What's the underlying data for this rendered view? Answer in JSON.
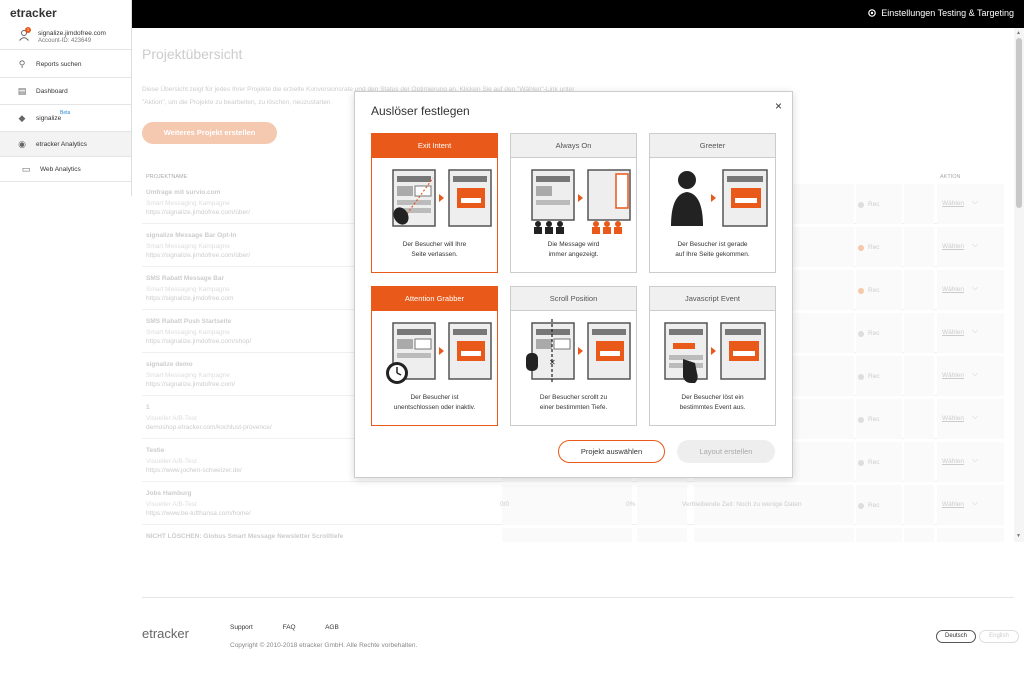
{
  "topbar": {
    "settings_label": "Einstellungen Testing & Targeting"
  },
  "sidebar": {
    "logo": "etracker",
    "account": {
      "name": "signalize.jimdofree.com",
      "id": "Account-ID: 423649"
    },
    "items": [
      {
        "label": "Reports suchen",
        "icon": "search-icon"
      },
      {
        "label": "Dashboard",
        "icon": "dashboard-icon"
      },
      {
        "label": "signalize",
        "icon": "signalize-icon",
        "badge": "Beta"
      },
      {
        "label": "etracker Analytics",
        "icon": "analytics-icon"
      },
      {
        "label": "Web Analytics",
        "icon": "web-analytics-icon"
      }
    ]
  },
  "main": {
    "title": "Projektübersicht",
    "description_1": "Diese Übersicht zeigt für jedes Ihrer Projekte die erzielte Konversionsrate und den Status der Optimierung an. Klicken Sie auf den \"Wählen\"-Link unter",
    "description_2": "\"Aktion\", um die Projekte zu bearbeiten, zu löschen, neuzustarten",
    "new_button": "Weiteres Projekt erstellen",
    "headers": {
      "name": "PROJEKTNAME",
      "action": "AKTION"
    },
    "rows": [
      {
        "title": "Umfrage mit survio.com",
        "sub": "Smart Messaging Kampagne",
        "url": "https://signalize.jimdofree.com/über/",
        "c1": "",
        "c2": "",
        "c3": "enige Daten",
        "rec": "Rec",
        "rec_on": false,
        "action": "Wählen"
      },
      {
        "title": "signalize Message Bar Opt-In",
        "sub": "Smart Messaging Kampagne",
        "url": "https://signalize.jimdofree.com/über/",
        "c1": "",
        "c2": "",
        "c3": "enige Daten",
        "rec": "Rec",
        "rec_on": true,
        "action": "Wählen"
      },
      {
        "title": "SMS Rabatt Message Bar",
        "sub": "Smart Messaging Kampagne",
        "url": "https://signalize.jimdofree.com",
        "c1": "",
        "c2": "",
        "c3": "enige Daten",
        "rec": "Rec",
        "rec_on": true,
        "action": "Wählen"
      },
      {
        "title": "SMS Rabatt Push Startseite",
        "sub": "Smart Messaging Kampagne",
        "url": "https://signalize.jimdofree.com/shop/",
        "c1": "",
        "c2": "",
        "c3": "enige Daten",
        "rec": "Rec",
        "rec_on": false,
        "action": "Wählen"
      },
      {
        "title": "signalize demo",
        "sub": "Smart Messaging Kampagne",
        "url": "https://signalize.jimdofree.com/",
        "c1": "",
        "c2": "",
        "c3": "enige Daten",
        "rec": "Rec",
        "rec_on": false,
        "action": "Wählen"
      },
      {
        "title": "1",
        "sub": "Visueller A/B-Test",
        "url": "demoshop.etracker.com/kochlust-provence/",
        "c1": "",
        "c2": "",
        "c3": "enige Daten",
        "rec": "Rec",
        "rec_on": false,
        "action": "Wählen"
      },
      {
        "title": "Testie",
        "sub": "Visueller A/B-Test",
        "url": "https://www.jochen-schweizer.de/",
        "c1": "",
        "c2": "",
        "c3": "enige Daten",
        "rec": "Rec",
        "rec_on": false,
        "action": "Wählen"
      },
      {
        "title": "Jobs Hamburg",
        "sub": "Visueller A/B-Test",
        "url": "https://www.be-lufthansa.com/home/",
        "c1": "0/0",
        "c2": "0%",
        "c3": "Verbleibende Zeit: Noch zu wenige Daten",
        "rec": "Rec",
        "rec_on": false,
        "action": "Wählen"
      },
      {
        "title": "NICHT LÖSCHEN: Globus Smart Message Newsletter Scrolltiefe",
        "sub": "",
        "url": "",
        "c1": "",
        "c2": "",
        "c3": "",
        "rec": "",
        "rec_on": false,
        "action": ""
      }
    ]
  },
  "modal": {
    "title": "Auslöser festlegen",
    "close": "×",
    "cards": [
      {
        "title": "Exit Intent",
        "desc_1": "Der Besucher will Ihre",
        "desc_2": "Seite verlassen.",
        "selected": true
      },
      {
        "title": "Always On",
        "desc_1": "Die Message wird",
        "desc_2": "immer angezeigt.",
        "selected": false
      },
      {
        "title": "Greeter",
        "desc_1": "Der Besucher ist gerade",
        "desc_2": "auf Ihre Seite gekommen.",
        "selected": false
      },
      {
        "title": "Attention Grabber",
        "desc_1": "Der Besucher ist",
        "desc_2": "unentschlossen oder inaktiv.",
        "selected": true
      },
      {
        "title": "Scroll Position",
        "desc_1": "Der Besucher scrollt zu",
        "desc_2": "einer bestimmten Tiefe.",
        "selected": false
      },
      {
        "title": "Javascript Event",
        "desc_1": "Der Besucher löst ein",
        "desc_2": "bestimmtes Event aus.",
        "selected": false
      }
    ],
    "select_button": "Projekt auswählen",
    "layout_button": "Layout erstellen"
  },
  "footer": {
    "logo": "etracker",
    "links": [
      "Support",
      "FAQ",
      "AGB"
    ],
    "copyright": "Copyright © 2010-2018 etracker GmbH. Alle Rechte vorbehalten.",
    "languages": [
      "Deutsch",
      "English"
    ]
  },
  "colors": {
    "accent": "#e8591a",
    "topbar": "#000000"
  }
}
